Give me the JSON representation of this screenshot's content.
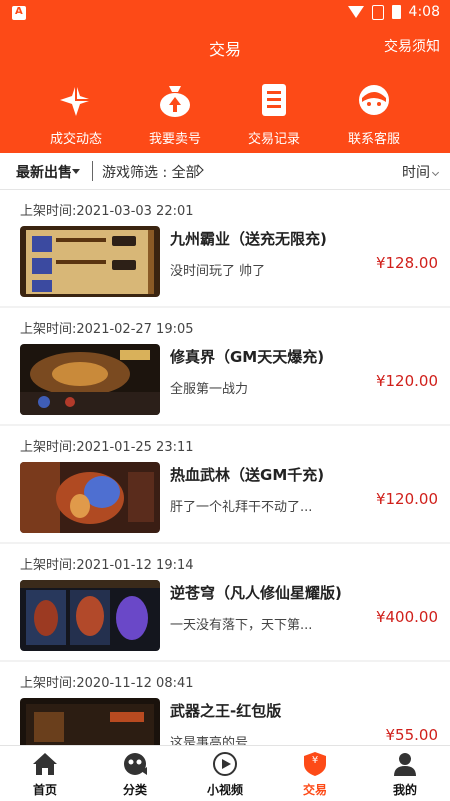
{
  "status_bar": {
    "time": "4:08"
  },
  "header": {
    "title": "交易",
    "notice": "交易须知"
  },
  "quick_actions": [
    {
      "label": "成交动态",
      "icon": "four-point-star-icon"
    },
    {
      "label": "我要卖号",
      "icon": "money-bag-icon"
    },
    {
      "label": "交易记录",
      "icon": "record-list-icon"
    },
    {
      "label": "联系客服",
      "icon": "customer-service-icon"
    }
  ],
  "filter": {
    "latest": "最新出售",
    "game_filter": "游戏筛选 : 全部",
    "sort": "时间"
  },
  "listings": [
    {
      "time": "上架时间:2021-03-03 22:01",
      "name": "九州霸业（送充无限充)",
      "desc": "没时间玩了 帅了",
      "price": "¥128.00"
    },
    {
      "time": "上架时间:2021-02-27 19:05",
      "name": "修真界（GM天天爆充)",
      "desc": "全服第一战力",
      "price": "¥120.00"
    },
    {
      "time": "上架时间:2021-01-25 23:11",
      "name": "热血武林（送GM千充)",
      "desc": "肝了一个礼拜干不动了...",
      "price": "¥120.00"
    },
    {
      "time": "上架时间:2021-01-12 19:14",
      "name": "逆苍穹（凡人修仙星耀版)",
      "desc": "一天没有落下，天下第...",
      "price": "¥400.00"
    },
    {
      "time": "上架时间:2020-11-12 08:41",
      "name": "武器之王-红包版",
      "desc": "这是事高的号",
      "price": "¥55.00"
    }
  ],
  "tabs": [
    {
      "label": "首页",
      "icon": "home-icon"
    },
    {
      "label": "分类",
      "icon": "category-icon"
    },
    {
      "label": "小视频",
      "icon": "video-play-icon"
    },
    {
      "label": "交易",
      "icon": "trade-shield-icon",
      "active": true,
      "badge": "¥"
    },
    {
      "label": "我的",
      "icon": "user-icon"
    }
  ],
  "colors": {
    "brand": "#fd4a17",
    "price": "#d0201b"
  }
}
